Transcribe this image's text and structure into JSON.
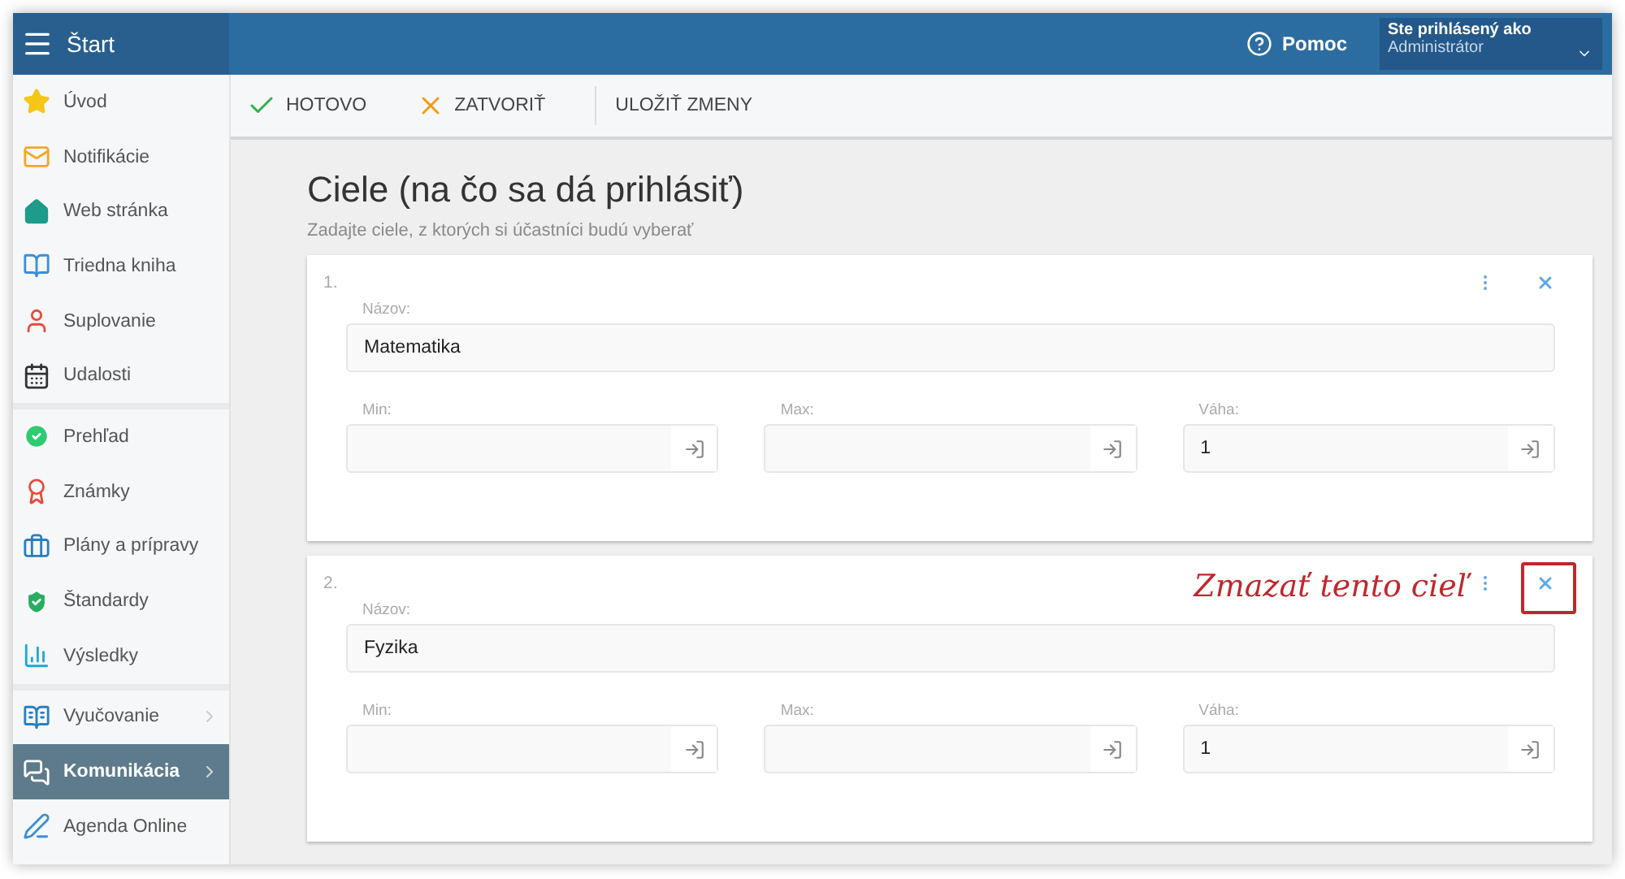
{
  "header": {
    "title": "Štart",
    "help": "Pomoc",
    "user_label": "Ste prihlásený ako",
    "user_name": "Administrátor"
  },
  "sidebar": {
    "groups": [
      {
        "items": [
          {
            "label": "Úvod",
            "selected": false,
            "expandable": false
          },
          {
            "label": "Notifikácie",
            "selected": false,
            "expandable": false
          },
          {
            "label": "Web stránka",
            "selected": false,
            "expandable": false
          },
          {
            "label": "Triedna kniha",
            "selected": false,
            "expandable": false
          },
          {
            "label": "Suplovanie",
            "selected": false,
            "expandable": false
          },
          {
            "label": "Udalosti",
            "selected": false,
            "expandable": false
          }
        ]
      },
      {
        "items": [
          {
            "label": "Prehľad",
            "selected": false,
            "expandable": false
          },
          {
            "label": "Známky",
            "selected": false,
            "expandable": false
          },
          {
            "label": "Plány a prípravy",
            "selected": false,
            "expandable": false
          },
          {
            "label": "Štandardy",
            "selected": false,
            "expandable": false
          },
          {
            "label": "Výsledky",
            "selected": false,
            "expandable": false
          }
        ]
      },
      {
        "items": [
          {
            "label": "Vyučovanie",
            "selected": false,
            "expandable": true
          },
          {
            "label": "Komunikácia",
            "selected": true,
            "expandable": true
          },
          {
            "label": "Agenda Online",
            "selected": false,
            "expandable": false
          }
        ]
      }
    ]
  },
  "toolbar": [
    {
      "kind": "done",
      "label": "HOTOVO"
    },
    {
      "kind": "close",
      "label": "ZATVORIŤ"
    },
    {
      "kind": "save",
      "label": "ULOŽIŤ ZMENY"
    }
  ],
  "page": {
    "title": "Ciele (na čo sa dá prihlásiť)",
    "subtitle": "Zadajte ciele, z ktorých si účastníci budú vyberať"
  },
  "goals": [
    {
      "number": "1.",
      "highlighted": false,
      "name_label": "Názov:",
      "name": "Matematika",
      "fields": [
        {
          "label": "Min:"
        },
        {
          "label": "Max:"
        },
        {
          "label": "Váha:",
          "value": "1"
        }
      ]
    },
    {
      "number": "2.",
      "highlighted": true,
      "name_label": "Názov:",
      "name": "Fyzika",
      "fields": [
        {
          "label": "Min:"
        },
        {
          "label": "Max:"
        },
        {
          "label": "Váha:",
          "value": "1"
        }
      ]
    }
  ],
  "annotation": "Zmazať tento cieľ"
}
